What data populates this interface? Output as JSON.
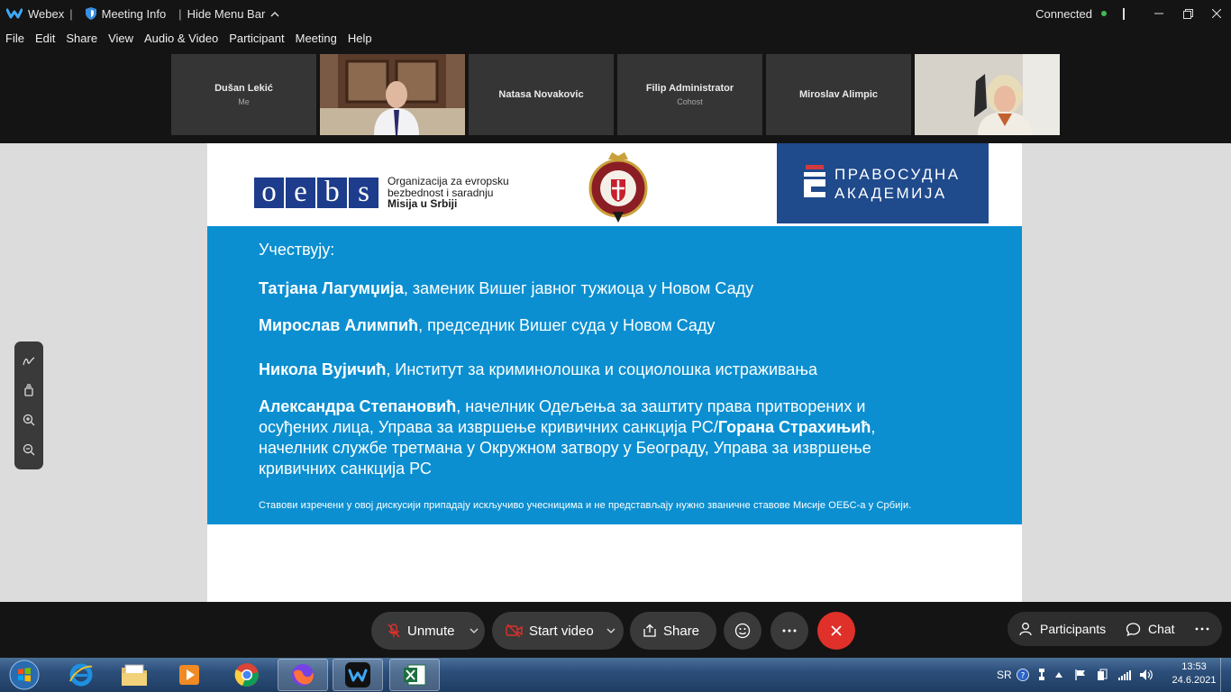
{
  "titlebar": {
    "app": "Webex",
    "meeting_info": "Meeting Info",
    "hide_menu": "Hide Menu Bar",
    "connection": "Connected"
  },
  "menu": [
    "File",
    "Edit",
    "Share",
    "View",
    "Audio & Video",
    "Participant",
    "Meeting",
    "Help"
  ],
  "participants": [
    {
      "name": "Dušan Lekić",
      "sub": "Me",
      "video": false
    },
    {
      "name": "",
      "sub": "",
      "video": true
    },
    {
      "name": "Natasa Novakovic",
      "sub": "",
      "video": false
    },
    {
      "name": "Filip Administrator",
      "sub": "Cohost",
      "video": false
    },
    {
      "name": "Miroslav Alimpic",
      "sub": "",
      "video": false
    },
    {
      "name": "",
      "sub": "",
      "video": true
    }
  ],
  "slide": {
    "oebs_letters": [
      "o",
      "e",
      "b",
      "s"
    ],
    "oebs_line1": "Organizacija za evropsku",
    "oebs_line2": "bezbednost i saradnju",
    "oebs_line3": "Misija u Srbiji",
    "akademija_line1": "ПРАВОСУДНА",
    "akademija_line2": "АКАДЕМИЈА",
    "heading": "Учествују:",
    "p1_bold": "Татјана Лагумџија",
    "p1_text": ", заменик Вишег јавног тужиоца у Новом Саду",
    "p2_bold": "Мирослав Алимпић",
    "p2_text": ", председник Вишег суда у Новом Саду",
    "p3_bold": "Никола Вујичић",
    "p3_text": ", Институт за криминолошка и социолошка истраживања",
    "p4_bold1": "Александра Степановић",
    "p4_text1": ", начелник Одељења за заштиту права притворених и осуђених лица, Управа за извршење кривичних санкција РС/",
    "p4_bold2": "Горана Страхињић",
    "p4_text2": ", начелник службе третмана у Окружном затвору у Београду, Управа за извршење кривичних санкција РС",
    "disclaimer": "Ставови изречени у овој дискусији припадају искључиво учесницима и не представљају нужно званичне ставове Мисије ОЕБС-а у Србији."
  },
  "controls": {
    "unmute": "Unmute",
    "start_video": "Start video",
    "share": "Share",
    "participants": "Participants",
    "chat": "Chat"
  },
  "taskbar": {
    "lang": "SR",
    "time": "13:53",
    "date": "24.6.2021"
  },
  "colors": {
    "slide_blue": "#0b8fd1",
    "akademija_blue": "#1f4a8c",
    "end_red": "#e0302a",
    "connected_green": "#3fb950"
  }
}
